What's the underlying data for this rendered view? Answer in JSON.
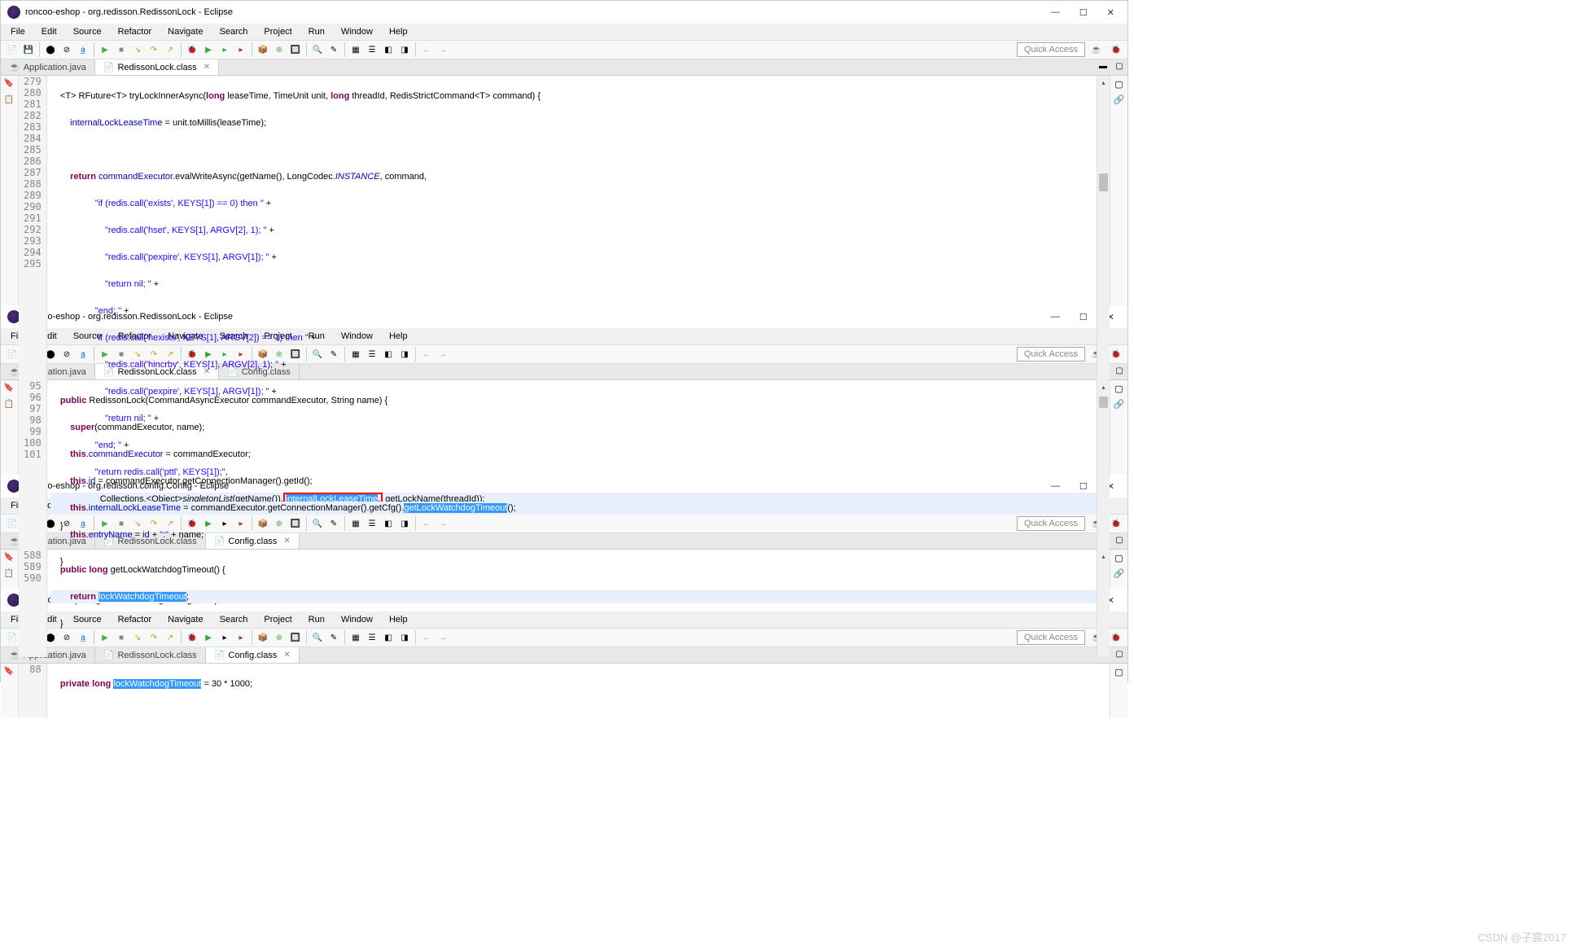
{
  "win1": {
    "title": "roncoo-eshop - org.redisson.RedissonLock - Eclipse",
    "menus": [
      "File",
      "Edit",
      "Source",
      "Refactor",
      "Navigate",
      "Search",
      "Project",
      "Run",
      "Window",
      "Help"
    ],
    "quick_access": "Quick Access",
    "tabs": [
      {
        "label": "Application.java",
        "active": false
      },
      {
        "label": "RedissonLock.class",
        "active": true
      }
    ],
    "lines_start": 279,
    "lines": [
      "    <T> RFuture<T> tryLockInnerAsync(long leaseTime, TimeUnit unit, long threadId, RedisStrictCommand<T> command) {",
      "        internalLockLeaseTime = unit.toMillis(leaseTime);",
      "",
      "        return commandExecutor.evalWriteAsync(getName(), LongCodec.INSTANCE, command,",
      "                  \"if (redis.call('exists', KEYS[1]) == 0) then \" +",
      "                      \"redis.call('hset', KEYS[1], ARGV[2], 1); \" +",
      "                      \"redis.call('pexpire', KEYS[1], ARGV[1]); \" +",
      "                      \"return nil; \" +",
      "                  \"end; \" +",
      "                  \"if (redis.call('hexists', KEYS[1], ARGV[2]) == 1) then \" +",
      "                      \"redis.call('hincrby', KEYS[1], ARGV[2], 1); \" +",
      "                      \"redis.call('pexpire', KEYS[1], ARGV[1]); \" +",
      "                      \"return nil; \" +",
      "                  \"end; \" +",
      "                  \"return redis.call('pttl', KEYS[1]);\",",
      "                    Collections.<Object>singletonList(getName()), internalLockLeaseTime, getLockName(threadId));",
      "    }"
    ],
    "highlighted_line_num": 294,
    "highlighted_token": "internalLockLeaseTime"
  },
  "win2": {
    "title": "roncoo-eshop - org.redisson.RedissonLock - Eclipse",
    "menus": [
      "File",
      "Edit",
      "Source",
      "Refactor",
      "Navigate",
      "Search",
      "Project",
      "Run",
      "Window",
      "Help"
    ],
    "quick_access": "Quick Access",
    "tabs": [
      {
        "label": "Application.java",
        "active": false
      },
      {
        "label": "RedissonLock.class",
        "active": true
      },
      {
        "label": "Config.class",
        "active": false
      }
    ],
    "lines_start": 95,
    "highlighted_line_num": 99,
    "selected_token": "getLockWatchdogTimeout"
  },
  "win3": {
    "title": "roncoo-eshop - org.redisson.config.Config - Eclipse",
    "menus": [
      "File",
      "Edit",
      "Source",
      "Refactor",
      "Navigate",
      "Search",
      "Project",
      "Run",
      "Window",
      "Help"
    ],
    "quick_access": "Quick Access",
    "tabs": [
      {
        "label": "Application.java",
        "active": false
      },
      {
        "label": "RedissonLock.class",
        "active": false
      },
      {
        "label": "Config.class",
        "active": true
      }
    ],
    "lines_start": 588,
    "highlighted_line_num": 589,
    "selected_token": "lockWatchdogTimeout"
  },
  "win4": {
    "title": "roncoo-eshop - org.redisson.config.Config - Eclipse",
    "menus": [
      "File",
      "Edit",
      "Source",
      "Refactor",
      "Navigate",
      "Search",
      "Project",
      "Run",
      "Window",
      "Help"
    ],
    "quick_access": "Quick Access",
    "tabs": [
      {
        "label": "Application.java",
        "active": false
      },
      {
        "label": "RedissonLock.class",
        "active": false
      },
      {
        "label": "Config.class",
        "active": true
      }
    ],
    "line_num": 88,
    "selected_token": "lockWatchdogTimeout",
    "assignment": " = 30 * 1000;"
  },
  "watermark": "CSDN @子宸2017"
}
